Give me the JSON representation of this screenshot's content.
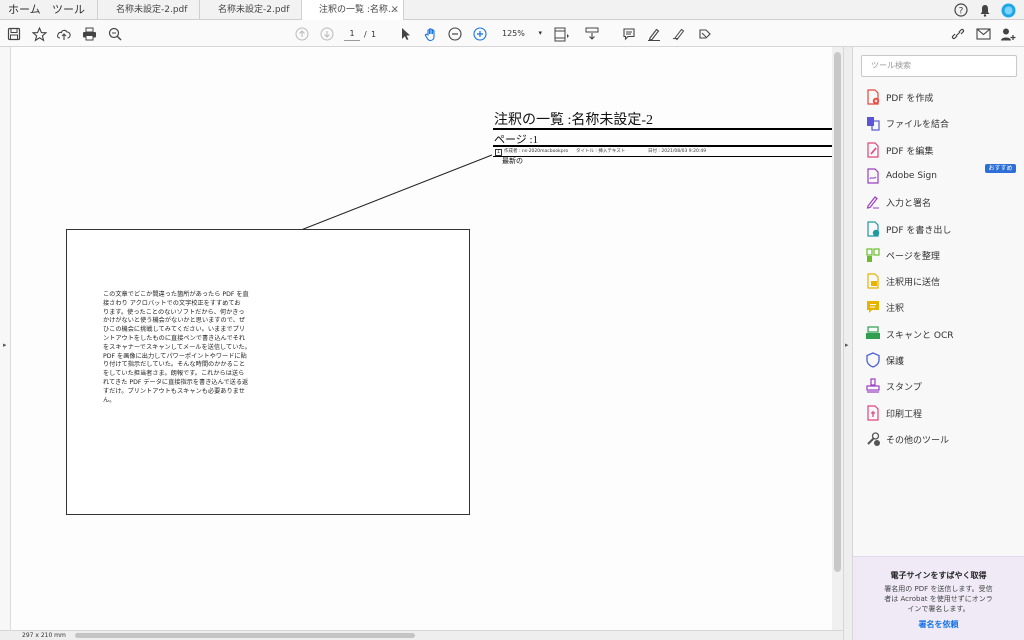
{
  "nav": {
    "home": "ホーム",
    "tools": "ツール"
  },
  "tabs": [
    {
      "label": "名称未設定-2.pdf"
    },
    {
      "label": "名称未設定-2.pdf"
    },
    {
      "label": "注釈の一覧 :名称...",
      "close": "×"
    }
  ],
  "toolbar": {
    "page_current": "1",
    "page_sep": "/",
    "page_total": "1",
    "zoom": "125%",
    "zoom_caret": "▾"
  },
  "summary": {
    "title": "注釈の一覧 :名称未設定-2",
    "page_label": "ページ :1",
    "comment_number": "1",
    "author": "作成者 : ns-2020macbookpro",
    "title_field": "タイトル : 挿入テキスト",
    "date": "日付 : 2021/08/03 9:20:49",
    "comment_text": "最新の"
  },
  "document": {
    "lines": [
      "この文章でどこか間違った箇所があったら PDF を直",
      "接さわり アクロバットでの文字校正をすすめてお",
      "ります。使ったことのないソフトだから、何かきっ",
      "かけがないと使う機会がないかと思いますので、ぜ",
      "ひこの機会に挑戦してみてください。いままでプリ",
      "ントアウトをしたものに直接ペンで書き込んでそれ",
      "をスキャナーでスキャンしてメールを送信していた。",
      "PDF を画像に出力してパワーポイントやワードに貼",
      "り付けて指示だしていた。そんな時間のかかること",
      "をしていた担当者さま。朗報です。これからは送ら",
      "れてきた PDF データに直接指示を書き込んで送る返",
      "すだけ。プリントアウトもスキャンも必要ありませ",
      "ん。"
    ]
  },
  "status": {
    "dimensions": "297 x 210 mm"
  },
  "panel": {
    "search_placeholder": "ツール検索",
    "tools": [
      {
        "label": "PDF を作成",
        "icon": "create-pdf-icon",
        "color": "#e04a3f"
      },
      {
        "label": "ファイルを結合",
        "icon": "combine-files-icon",
        "color": "#5a55d6"
      },
      {
        "label": "PDF を編集",
        "icon": "edit-pdf-icon",
        "color": "#e0457e"
      },
      {
        "label": "Adobe Sign",
        "icon": "adobe-sign-icon",
        "color": "#9b3ec4"
      },
      {
        "label": "入力と署名",
        "icon": "fill-sign-icon",
        "color": "#9b3ec4"
      },
      {
        "label": "PDF を書き出し",
        "icon": "export-pdf-icon",
        "color": "#1f9aa0"
      },
      {
        "label": "ページを整理",
        "icon": "organize-pages-icon",
        "color": "#6bbd2f"
      },
      {
        "label": "注釈用に送信",
        "icon": "send-comments-icon",
        "color": "#e6b400"
      },
      {
        "label": "注釈",
        "icon": "comment-icon",
        "color": "#e6b400"
      },
      {
        "label": "スキャンと OCR",
        "icon": "scan-ocr-icon",
        "color": "#2e9e4f"
      },
      {
        "label": "保護",
        "icon": "protect-icon",
        "color": "#4a5fd6"
      },
      {
        "label": "スタンプ",
        "icon": "stamp-icon",
        "color": "#9b3ec4"
      },
      {
        "label": "印刷工程",
        "icon": "print-production-icon",
        "color": "#e0457e"
      },
      {
        "label": "その他のツール",
        "icon": "more-tools-icon",
        "color": "#555555"
      }
    ],
    "badge": "おすすめ",
    "promo": {
      "title": "電子サインをすばやく取得",
      "body1": "署名用の PDF を送信します。受信",
      "body2": "者は Acrobat を使用せずにオンラ",
      "body3": "インで署名します。",
      "link": "署名を依頼"
    }
  },
  "colors": {
    "accent": "#1473e6",
    "active_tab": "#ffffff"
  }
}
